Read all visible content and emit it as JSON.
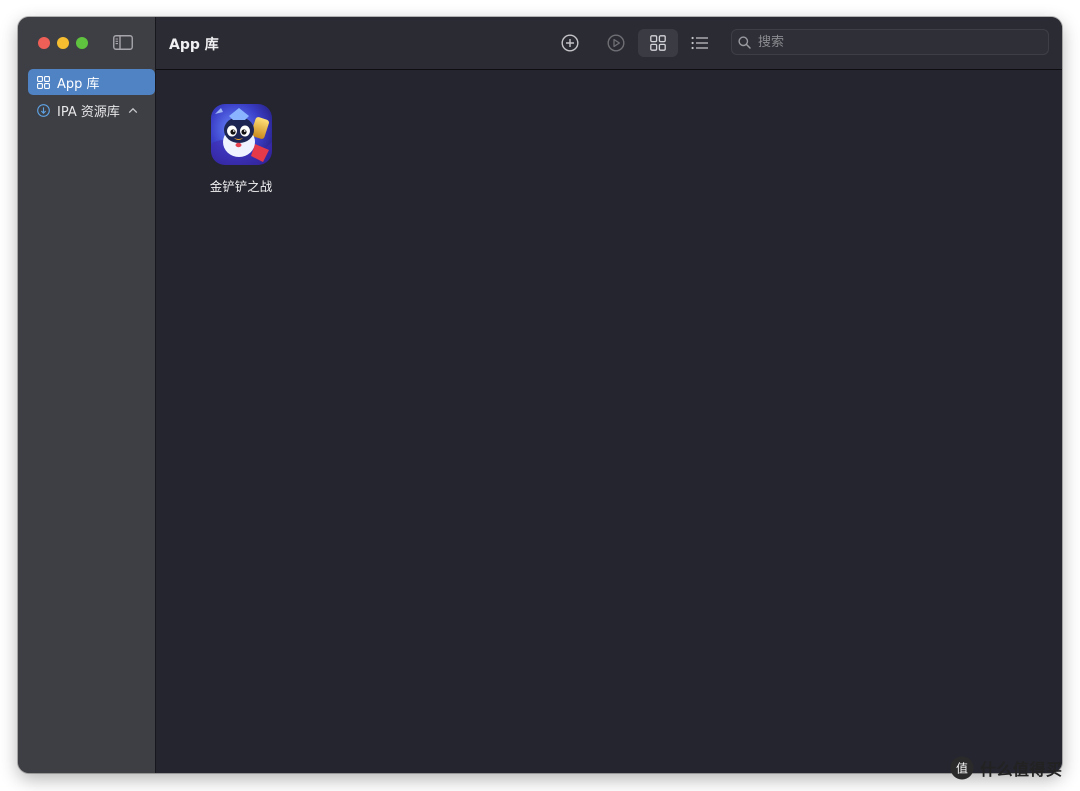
{
  "window": {
    "title": "App 库",
    "traffic_lights": [
      "close",
      "minimize",
      "zoom"
    ]
  },
  "sidebar": {
    "items": [
      {
        "label": "App 库",
        "icon": "grid-icon",
        "selected": true
      },
      {
        "label": "IPA 资源库",
        "icon": "download-circle-icon",
        "expanded": true
      }
    ]
  },
  "toolbar": {
    "buttons": [
      "plus-circle-icon",
      "play-circle-icon",
      "grid-view-icon",
      "list-view-icon"
    ],
    "active_view": "grid"
  },
  "search": {
    "placeholder": "搜索",
    "value": ""
  },
  "apps": [
    {
      "name": "金铲铲之战",
      "icon": "game-app-icon"
    }
  ],
  "watermark": {
    "text": "什么值得买",
    "badge": "值"
  },
  "colors": {
    "accent": "#4f83c4",
    "sidebar_bg": "#3e3f44",
    "content_bg": "#25252f",
    "toolbar_bg": "#2b2b33"
  }
}
